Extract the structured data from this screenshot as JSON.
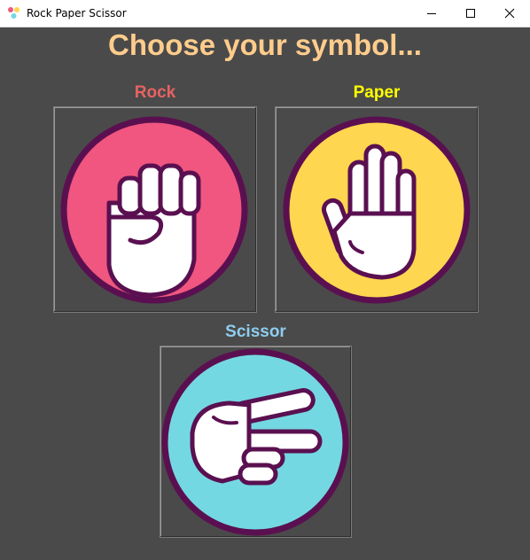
{
  "window": {
    "title": "Rock Paper Scissor",
    "icon": "game-icon",
    "controls": [
      "minimize-icon",
      "maximize-icon",
      "close-icon"
    ]
  },
  "heading": "Choose your symbol...",
  "choices": [
    {
      "label": "Rock",
      "icon": "rock-fist-icon",
      "label_color": "#e86262",
      "circle_color": "#f0567f"
    },
    {
      "label": "Paper",
      "icon": "paper-hand-icon",
      "label_color": "#ffff00",
      "circle_color": "#ffd64f"
    },
    {
      "label": "Scissor",
      "icon": "scissor-hand-icon",
      "label_color": "#8ecdf0",
      "circle_color": "#74d8e2"
    }
  ],
  "colors": {
    "background": "#4a4a4a",
    "heading": "#ffcc8c",
    "outline": "#5a1050",
    "hand": "#ffffff"
  }
}
